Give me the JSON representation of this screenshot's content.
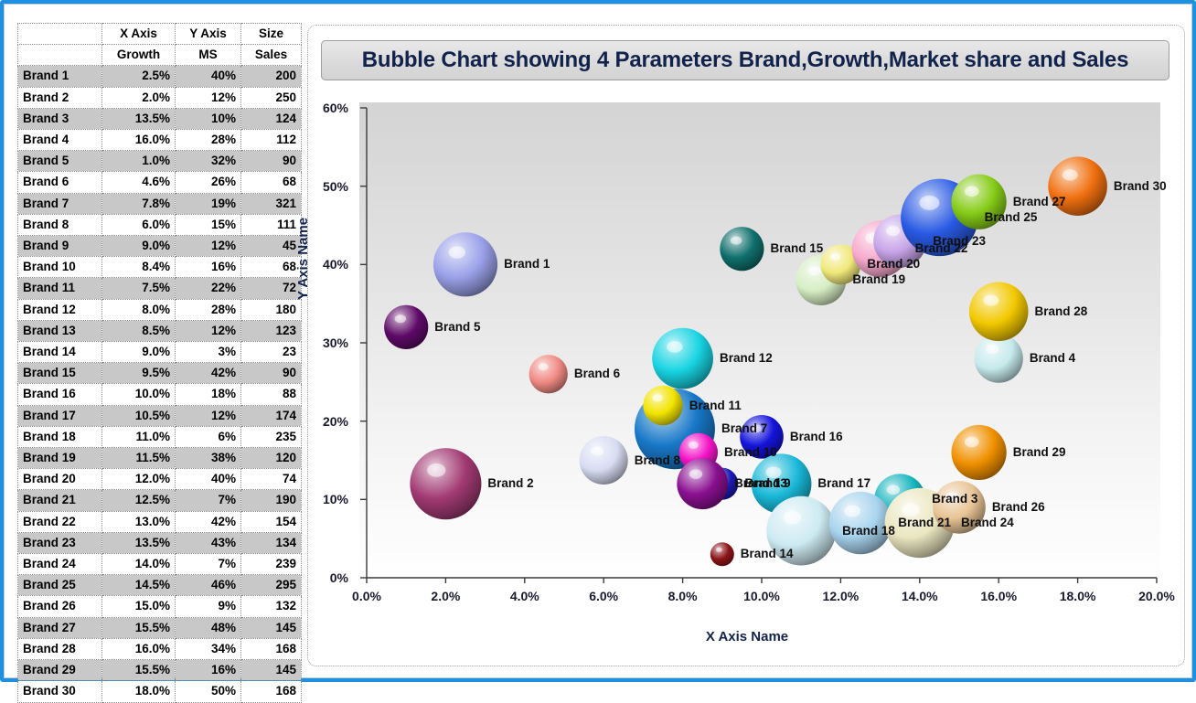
{
  "window": {
    "border_color": "#1e90dd"
  },
  "table": {
    "header_row_1": [
      "",
      "X Axis",
      "Y Axis",
      "Size"
    ],
    "header_row_2": [
      "",
      "Growth",
      "MS",
      "Sales"
    ],
    "rows": [
      {
        "brand": "Brand 1",
        "growth": "2.5%",
        "ms": "40%",
        "sales": "200"
      },
      {
        "brand": "Brand 2",
        "growth": "2.0%",
        "ms": "12%",
        "sales": "250"
      },
      {
        "brand": "Brand 3",
        "growth": "13.5%",
        "ms": "10%",
        "sales": "124"
      },
      {
        "brand": "Brand 4",
        "growth": "16.0%",
        "ms": "28%",
        "sales": "112"
      },
      {
        "brand": "Brand 5",
        "growth": "1.0%",
        "ms": "32%",
        "sales": "90"
      },
      {
        "brand": "Brand 6",
        "growth": "4.6%",
        "ms": "26%",
        "sales": "68"
      },
      {
        "brand": "Brand 7",
        "growth": "7.8%",
        "ms": "19%",
        "sales": "321"
      },
      {
        "brand": "Brand 8",
        "growth": "6.0%",
        "ms": "15%",
        "sales": "111"
      },
      {
        "brand": "Brand 9",
        "growth": "9.0%",
        "ms": "12%",
        "sales": "45"
      },
      {
        "brand": "Brand 10",
        "growth": "8.4%",
        "ms": "16%",
        "sales": "68"
      },
      {
        "brand": "Brand 11",
        "growth": "7.5%",
        "ms": "22%",
        "sales": "72"
      },
      {
        "brand": "Brand 12",
        "growth": "8.0%",
        "ms": "28%",
        "sales": "180"
      },
      {
        "brand": "Brand 13",
        "growth": "8.5%",
        "ms": "12%",
        "sales": "123"
      },
      {
        "brand": "Brand 14",
        "growth": "9.0%",
        "ms": "3%",
        "sales": "23"
      },
      {
        "brand": "Brand 15",
        "growth": "9.5%",
        "ms": "42%",
        "sales": "90"
      },
      {
        "brand": "Brand 16",
        "growth": "10.0%",
        "ms": "18%",
        "sales": "88"
      },
      {
        "brand": "Brand 17",
        "growth": "10.5%",
        "ms": "12%",
        "sales": "174"
      },
      {
        "brand": "Brand 18",
        "growth": "11.0%",
        "ms": "6%",
        "sales": "235"
      },
      {
        "brand": "Brand 19",
        "growth": "11.5%",
        "ms": "38%",
        "sales": "120"
      },
      {
        "brand": "Brand 20",
        "growth": "12.0%",
        "ms": "40%",
        "sales": "74"
      },
      {
        "brand": "Brand 21",
        "growth": "12.5%",
        "ms": "7%",
        "sales": "190"
      },
      {
        "brand": "Brand 22",
        "growth": "13.0%",
        "ms": "42%",
        "sales": "154"
      },
      {
        "brand": "Brand 23",
        "growth": "13.5%",
        "ms": "43%",
        "sales": "134"
      },
      {
        "brand": "Brand 24",
        "growth": "14.0%",
        "ms": "7%",
        "sales": "239"
      },
      {
        "brand": "Brand 25",
        "growth": "14.5%",
        "ms": "46%",
        "sales": "295"
      },
      {
        "brand": "Brand 26",
        "growth": "15.0%",
        "ms": "9%",
        "sales": "132"
      },
      {
        "brand": "Brand 27",
        "growth": "15.5%",
        "ms": "48%",
        "sales": "145"
      },
      {
        "brand": "Brand 28",
        "growth": "16.0%",
        "ms": "34%",
        "sales": "168"
      },
      {
        "brand": "Brand 29",
        "growth": "15.5%",
        "ms": "16%",
        "sales": "145"
      },
      {
        "brand": "Brand 30",
        "growth": "18.0%",
        "ms": "50%",
        "sales": "168"
      }
    ]
  },
  "chart": {
    "title": "Bubble Chart showing 4 Parameters Brand,Growth,Market share and Sales",
    "x_axis_title": "X Axis Name",
    "y_axis_title": "Y Axis Name",
    "x_ticks": [
      "0.0%",
      "2.0%",
      "4.0%",
      "6.0%",
      "8.0%",
      "10.0%",
      "12.0%",
      "14.0%",
      "16.0%",
      "18.0%",
      "20.0%"
    ],
    "y_ticks": [
      "0%",
      "10%",
      "20%",
      "30%",
      "40%",
      "50%",
      "60%"
    ]
  },
  "chart_data": {
    "type": "scatter",
    "title": "Bubble Chart showing 4 Parameters Brand,Growth,Market share and Sales",
    "xlabel": "X Axis Name",
    "ylabel": "Y Axis Name",
    "xlim": [
      0,
      20
    ],
    "ylim": [
      0,
      60
    ],
    "x_unit": "percent",
    "y_unit": "percent",
    "size_field": "Sales",
    "grid": false,
    "legend": false,
    "points": [
      {
        "label": "Brand 1",
        "x": 2.5,
        "y": 40,
        "size": 200,
        "color": "#9aa0e8"
      },
      {
        "label": "Brand 2",
        "x": 2.0,
        "y": 12,
        "size": 250,
        "color": "#a23a73"
      },
      {
        "label": "Brand 3",
        "x": 13.5,
        "y": 10,
        "size": 124,
        "color": "#17b5bd"
      },
      {
        "label": "Brand 4",
        "x": 16.0,
        "y": 28,
        "size": 112,
        "color": "#c6eaec"
      },
      {
        "label": "Brand 5",
        "x": 1.0,
        "y": 32,
        "size": 90,
        "color": "#5e0a68"
      },
      {
        "label": "Brand 6",
        "x": 4.6,
        "y": 26,
        "size": 68,
        "color": "#f08a84"
      },
      {
        "label": "Brand 7",
        "x": 7.8,
        "y": 19,
        "size": 321,
        "color": "#1878c8"
      },
      {
        "label": "Brand 8",
        "x": 6.0,
        "y": 15,
        "size": 111,
        "color": "#d8dcf2"
      },
      {
        "label": "Brand 9",
        "x": 9.0,
        "y": 12,
        "size": 45,
        "color": "#1a1ab4"
      },
      {
        "label": "Brand 10",
        "x": 8.4,
        "y": 16,
        "size": 68,
        "color": "#f414c8"
      },
      {
        "label": "Brand 11",
        "x": 7.5,
        "y": 22,
        "size": 72,
        "color": "#f2e400"
      },
      {
        "label": "Brand 12",
        "x": 8.0,
        "y": 28,
        "size": 180,
        "color": "#18d4e2"
      },
      {
        "label": "Brand 13",
        "x": 8.5,
        "y": 12,
        "size": 123,
        "color": "#8a1090"
      },
      {
        "label": "Brand 14",
        "x": 9.0,
        "y": 3,
        "size": 23,
        "color": "#8c1418"
      },
      {
        "label": "Brand 15",
        "x": 9.5,
        "y": 42,
        "size": 90,
        "color": "#0f6f6c"
      },
      {
        "label": "Brand 16",
        "x": 10.0,
        "y": 18,
        "size": 88,
        "color": "#1414dc"
      },
      {
        "label": "Brand 17",
        "x": 10.5,
        "y": 12,
        "size": 174,
        "color": "#1ab8d8"
      },
      {
        "label": "Brand 18",
        "x": 11.0,
        "y": 6,
        "size": 235,
        "color": "#cdeaf2"
      },
      {
        "label": "Brand 19",
        "x": 11.5,
        "y": 38,
        "size": 120,
        "color": "#d6eec4"
      },
      {
        "label": "Brand 20",
        "x": 12.0,
        "y": 40,
        "size": 74,
        "color": "#f0e87a"
      },
      {
        "label": "Brand 21",
        "x": 12.5,
        "y": 7,
        "size": 190,
        "color": "#a8d4ee"
      },
      {
        "label": "Brand 22",
        "x": 13.0,
        "y": 42,
        "size": 154,
        "color": "#f6a8cc"
      },
      {
        "label": "Brand 23",
        "x": 13.5,
        "y": 43,
        "size": 134,
        "color": "#c8a4e8"
      },
      {
        "label": "Brand 24",
        "x": 14.0,
        "y": 7,
        "size": 239,
        "color": "#eae6c0"
      },
      {
        "label": "Brand 25",
        "x": 14.5,
        "y": 46,
        "size": 295,
        "color": "#2a5ae4"
      },
      {
        "label": "Brand 26",
        "x": 15.0,
        "y": 9,
        "size": 132,
        "color": "#e8c496"
      },
      {
        "label": "Brand 27",
        "x": 15.5,
        "y": 48,
        "size": 145,
        "color": "#86cc18"
      },
      {
        "label": "Brand 28",
        "x": 16.0,
        "y": 34,
        "size": 168,
        "color": "#f2c800"
      },
      {
        "label": "Brand 29",
        "x": 15.5,
        "y": 16,
        "size": 145,
        "color": "#f09000"
      },
      {
        "label": "Brand 30",
        "x": 18.0,
        "y": 50,
        "size": 168,
        "color": "#f07010"
      }
    ]
  }
}
